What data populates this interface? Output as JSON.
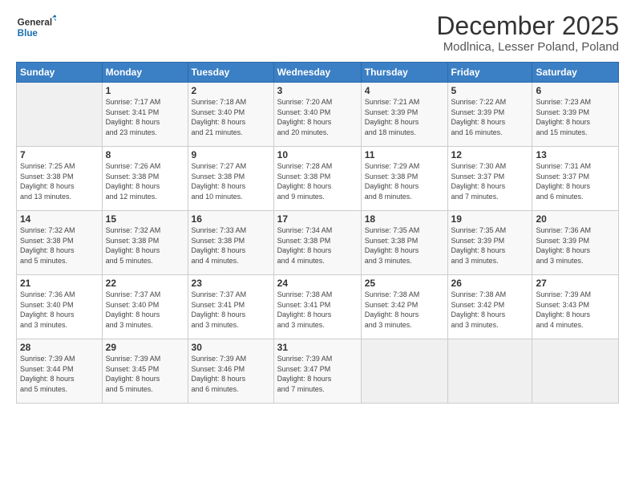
{
  "logo": {
    "line1": "General",
    "line2": "Blue"
  },
  "title": "December 2025",
  "subtitle": "Modlnica, Lesser Poland, Poland",
  "days_header": [
    "Sunday",
    "Monday",
    "Tuesday",
    "Wednesday",
    "Thursday",
    "Friday",
    "Saturday"
  ],
  "weeks": [
    [
      {
        "day": "",
        "info": ""
      },
      {
        "day": "1",
        "info": "Sunrise: 7:17 AM\nSunset: 3:41 PM\nDaylight: 8 hours\nand 23 minutes."
      },
      {
        "day": "2",
        "info": "Sunrise: 7:18 AM\nSunset: 3:40 PM\nDaylight: 8 hours\nand 21 minutes."
      },
      {
        "day": "3",
        "info": "Sunrise: 7:20 AM\nSunset: 3:40 PM\nDaylight: 8 hours\nand 20 minutes."
      },
      {
        "day": "4",
        "info": "Sunrise: 7:21 AM\nSunset: 3:39 PM\nDaylight: 8 hours\nand 18 minutes."
      },
      {
        "day": "5",
        "info": "Sunrise: 7:22 AM\nSunset: 3:39 PM\nDaylight: 8 hours\nand 16 minutes."
      },
      {
        "day": "6",
        "info": "Sunrise: 7:23 AM\nSunset: 3:39 PM\nDaylight: 8 hours\nand 15 minutes."
      }
    ],
    [
      {
        "day": "7",
        "info": "Sunrise: 7:25 AM\nSunset: 3:38 PM\nDaylight: 8 hours\nand 13 minutes."
      },
      {
        "day": "8",
        "info": "Sunrise: 7:26 AM\nSunset: 3:38 PM\nDaylight: 8 hours\nand 12 minutes."
      },
      {
        "day": "9",
        "info": "Sunrise: 7:27 AM\nSunset: 3:38 PM\nDaylight: 8 hours\nand 10 minutes."
      },
      {
        "day": "10",
        "info": "Sunrise: 7:28 AM\nSunset: 3:38 PM\nDaylight: 8 hours\nand 9 minutes."
      },
      {
        "day": "11",
        "info": "Sunrise: 7:29 AM\nSunset: 3:38 PM\nDaylight: 8 hours\nand 8 minutes."
      },
      {
        "day": "12",
        "info": "Sunrise: 7:30 AM\nSunset: 3:37 PM\nDaylight: 8 hours\nand 7 minutes."
      },
      {
        "day": "13",
        "info": "Sunrise: 7:31 AM\nSunset: 3:37 PM\nDaylight: 8 hours\nand 6 minutes."
      }
    ],
    [
      {
        "day": "14",
        "info": "Sunrise: 7:32 AM\nSunset: 3:38 PM\nDaylight: 8 hours\nand 5 minutes."
      },
      {
        "day": "15",
        "info": "Sunrise: 7:32 AM\nSunset: 3:38 PM\nDaylight: 8 hours\nand 5 minutes."
      },
      {
        "day": "16",
        "info": "Sunrise: 7:33 AM\nSunset: 3:38 PM\nDaylight: 8 hours\nand 4 minutes."
      },
      {
        "day": "17",
        "info": "Sunrise: 7:34 AM\nSunset: 3:38 PM\nDaylight: 8 hours\nand 4 minutes."
      },
      {
        "day": "18",
        "info": "Sunrise: 7:35 AM\nSunset: 3:38 PM\nDaylight: 8 hours\nand 3 minutes."
      },
      {
        "day": "19",
        "info": "Sunrise: 7:35 AM\nSunset: 3:39 PM\nDaylight: 8 hours\nand 3 minutes."
      },
      {
        "day": "20",
        "info": "Sunrise: 7:36 AM\nSunset: 3:39 PM\nDaylight: 8 hours\nand 3 minutes."
      }
    ],
    [
      {
        "day": "21",
        "info": "Sunrise: 7:36 AM\nSunset: 3:40 PM\nDaylight: 8 hours\nand 3 minutes."
      },
      {
        "day": "22",
        "info": "Sunrise: 7:37 AM\nSunset: 3:40 PM\nDaylight: 8 hours\nand 3 minutes."
      },
      {
        "day": "23",
        "info": "Sunrise: 7:37 AM\nSunset: 3:41 PM\nDaylight: 8 hours\nand 3 minutes."
      },
      {
        "day": "24",
        "info": "Sunrise: 7:38 AM\nSunset: 3:41 PM\nDaylight: 8 hours\nand 3 minutes."
      },
      {
        "day": "25",
        "info": "Sunrise: 7:38 AM\nSunset: 3:42 PM\nDaylight: 8 hours\nand 3 minutes."
      },
      {
        "day": "26",
        "info": "Sunrise: 7:38 AM\nSunset: 3:42 PM\nDaylight: 8 hours\nand 3 minutes."
      },
      {
        "day": "27",
        "info": "Sunrise: 7:39 AM\nSunset: 3:43 PM\nDaylight: 8 hours\nand 4 minutes."
      }
    ],
    [
      {
        "day": "28",
        "info": "Sunrise: 7:39 AM\nSunset: 3:44 PM\nDaylight: 8 hours\nand 5 minutes."
      },
      {
        "day": "29",
        "info": "Sunrise: 7:39 AM\nSunset: 3:45 PM\nDaylight: 8 hours\nand 5 minutes."
      },
      {
        "day": "30",
        "info": "Sunrise: 7:39 AM\nSunset: 3:46 PM\nDaylight: 8 hours\nand 6 minutes."
      },
      {
        "day": "31",
        "info": "Sunrise: 7:39 AM\nSunset: 3:47 PM\nDaylight: 8 hours\nand 7 minutes."
      },
      {
        "day": "",
        "info": ""
      },
      {
        "day": "",
        "info": ""
      },
      {
        "day": "",
        "info": ""
      }
    ]
  ]
}
